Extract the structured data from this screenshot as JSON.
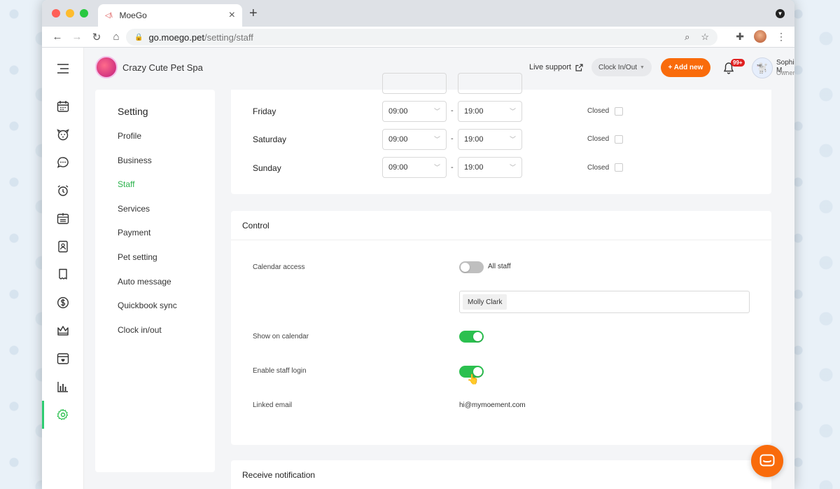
{
  "browser": {
    "tab_title": "MoeGo",
    "tab_favicon": "◁\\",
    "url_host": "go.moego.pet",
    "url_path": "/setting/staff"
  },
  "header": {
    "business_name": "Crazy Cute Pet Spa",
    "live_support": "Live support",
    "clock_button": "Clock In/Out",
    "add_new_button": "+ Add new",
    "notification_badge": "99+",
    "user_name": "Sophia M...",
    "user_role": "Owner"
  },
  "settings_menu": {
    "title": "Setting",
    "items": [
      "Profile",
      "Business",
      "Staff",
      "Services",
      "Payment",
      "Pet setting",
      "Auto message",
      "Quickbook sync",
      "Clock in/out"
    ],
    "active": "Staff"
  },
  "hours": {
    "rows": [
      {
        "day": "Friday",
        "start": "09:00",
        "end": "19:00",
        "closed_label": "Closed"
      },
      {
        "day": "Saturday",
        "start": "09:00",
        "end": "19:00",
        "closed_label": "Closed"
      },
      {
        "day": "Sunday",
        "start": "09:00",
        "end": "19:00",
        "closed_label": "Closed"
      }
    ],
    "separator": "-"
  },
  "control": {
    "title": "Control",
    "calendar_access_label": "Calendar access",
    "all_staff_label": "All staff",
    "all_staff_on": false,
    "selected_staff": "Molly Clark",
    "show_on_calendar_label": "Show on calendar",
    "show_on_calendar_on": true,
    "enable_login_label": "Enable staff login",
    "enable_login_on": true,
    "linked_email_label": "Linked email",
    "linked_email": "hi@mymoement.com"
  },
  "notification": {
    "title": "Receive notification"
  },
  "colors": {
    "accent_green": "#2bc04f",
    "brand_orange": "#f96b0b"
  }
}
